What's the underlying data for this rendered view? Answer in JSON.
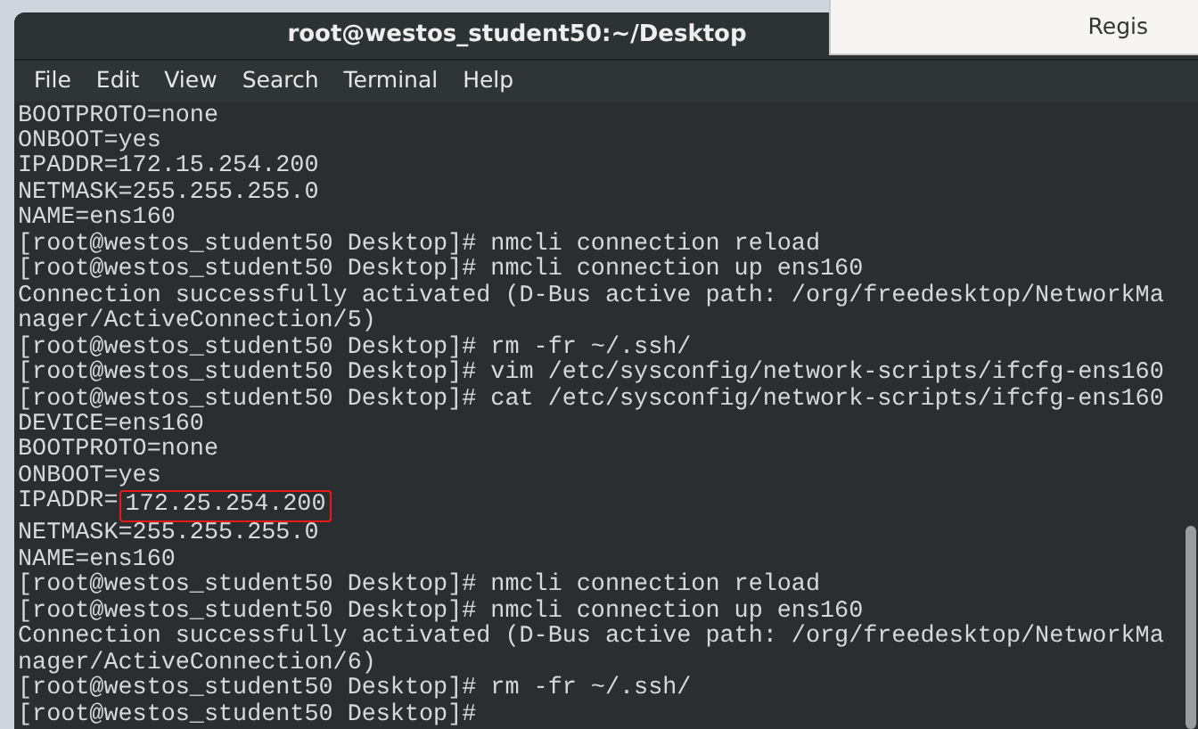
{
  "terminal": {
    "title": "root@westos_student50:~/Desktop",
    "menu": [
      "File",
      "Edit",
      "View",
      "Search",
      "Terminal",
      "Help"
    ],
    "lines": [
      {
        "text": "BOOTPROTO=none"
      },
      {
        "text": "ONBOOT=yes"
      },
      {
        "text": "IPADDR=172.15.254.200"
      },
      {
        "text": "NETMASK=255.255.255.0"
      },
      {
        "text": "NAME=ens160"
      },
      {
        "text": "[root@westos_student50 Desktop]# nmcli connection reload"
      },
      {
        "text": "[root@westos_student50 Desktop]# nmcli connection up ens160"
      },
      {
        "text": "Connection successfully activated (D-Bus active path: /org/freedesktop/NetworkMa"
      },
      {
        "text": "nager/ActiveConnection/5)"
      },
      {
        "text": "[root@westos_student50 Desktop]# rm -fr ~/.ssh/"
      },
      {
        "text": "[root@westos_student50 Desktop]# vim /etc/sysconfig/network-scripts/ifcfg-ens160"
      },
      {
        "text": "[root@westos_student50 Desktop]# cat /etc/sysconfig/network-scripts/ifcfg-ens160"
      },
      {
        "text": "DEVICE=ens160"
      },
      {
        "text": "BOOTPROTO=none"
      },
      {
        "text": "ONBOOT=yes"
      },
      {
        "text": "IPADDR=",
        "boxed": "172.25.254.200"
      },
      {
        "text": "NETMASK=255.255.255.0"
      },
      {
        "text": "NAME=ens160"
      },
      {
        "text": "[root@westos_student50 Desktop]# nmcli connection reload"
      },
      {
        "text": "[root@westos_student50 Desktop]# nmcli connection up ens160"
      },
      {
        "text": "Connection successfully activated (D-Bus active path: /org/freedesktop/NetworkMa"
      },
      {
        "text": "nager/ActiveConnection/6)"
      },
      {
        "text": "[root@westos_student50 Desktop]# rm -fr ~/.ssh/"
      },
      {
        "text": "[root@westos_student50 Desktop]#"
      }
    ]
  },
  "background_window": {
    "title": "Regis"
  }
}
